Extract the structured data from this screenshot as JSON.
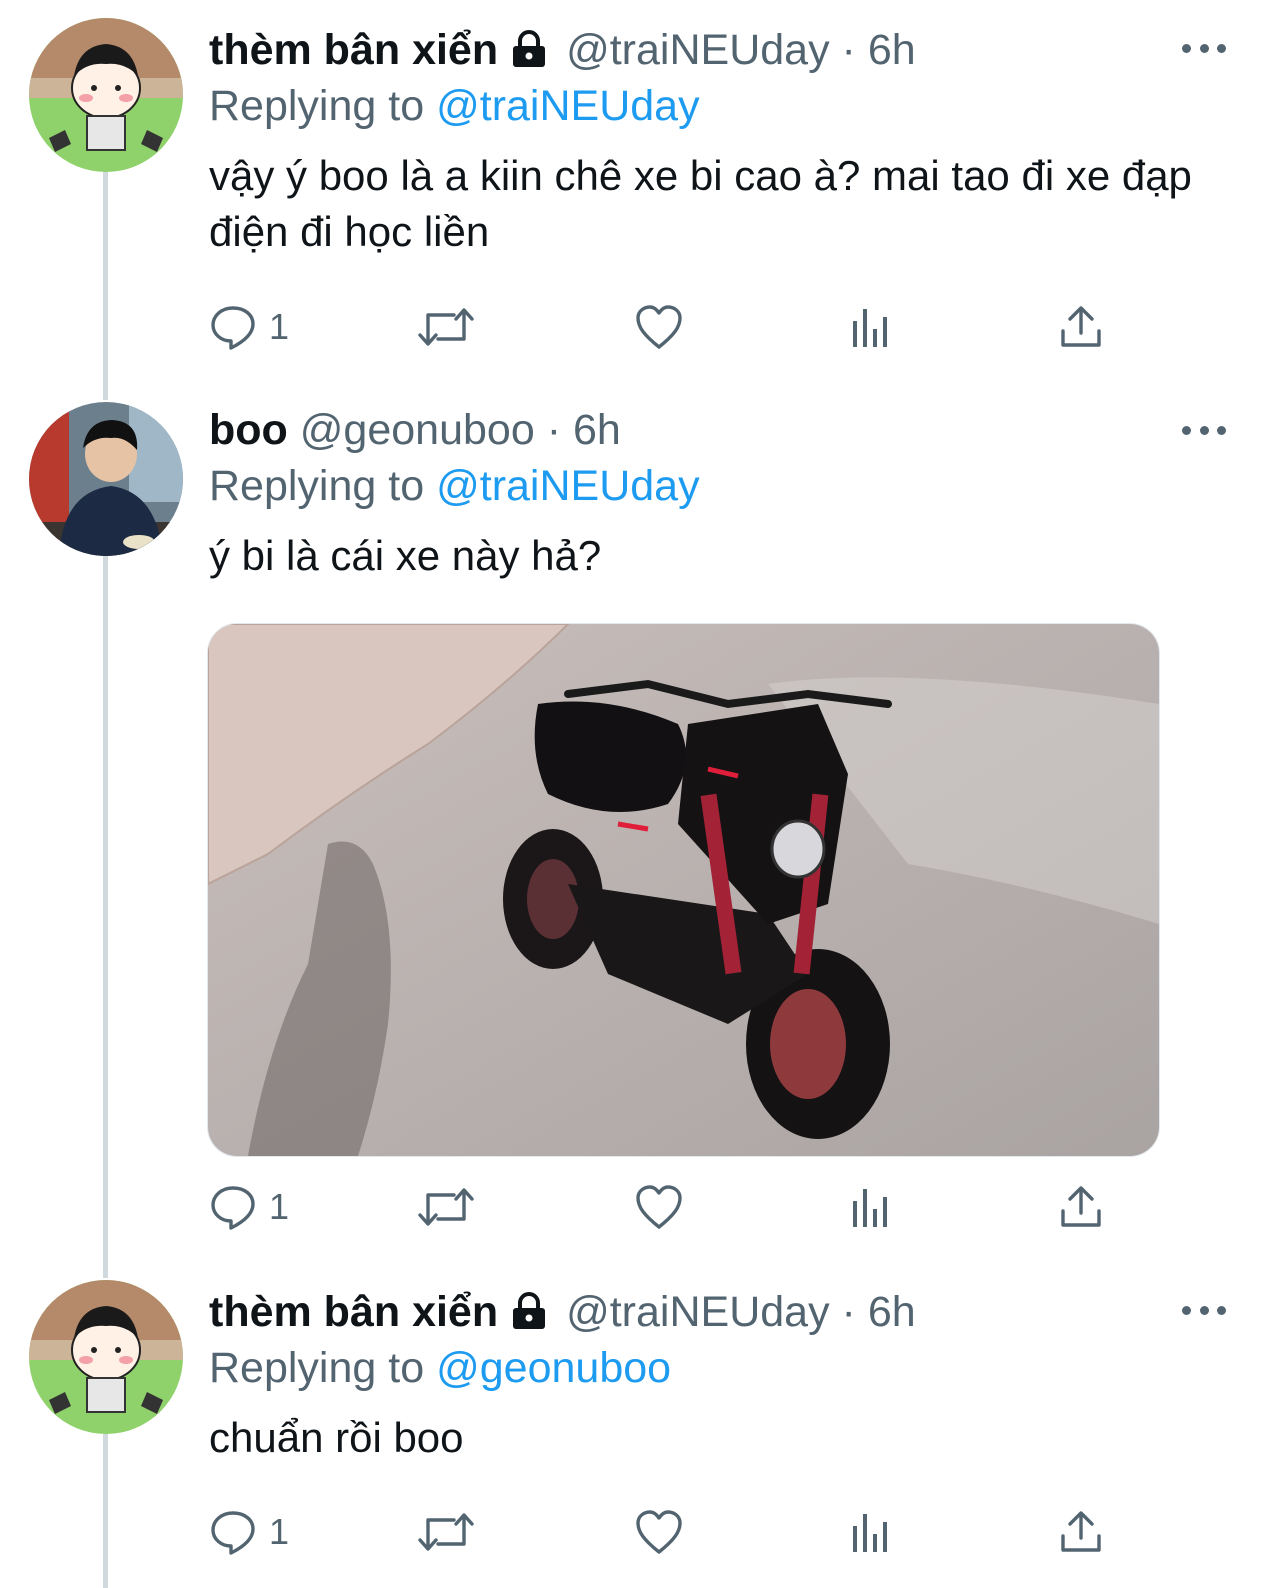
{
  "tweets": [
    {
      "name": "thèm bân xiển",
      "handle": "@traiNEUday",
      "dot": "·",
      "time": "6h",
      "replying_prefix": "Replying to",
      "replying_to": "@traiNEUday",
      "text": "vậy ý boo là a kiin chê xe bi cao à? mai tao đi xe đạp điện đi học liền",
      "reply_count": "1",
      "locked": true
    },
    {
      "name": "boo",
      "handle": "@geonuboo",
      "dot": "·",
      "time": "6h",
      "replying_prefix": "Replying to",
      "replying_to": "@traiNEUday",
      "text": "ý bi là cái xe này hả?",
      "reply_count": "1",
      "locked": false
    },
    {
      "name": "thèm bân xiển",
      "handle": "@traiNEUday",
      "dot": "·",
      "time": "6h",
      "replying_prefix": "Replying to",
      "replying_to": "@geonuboo",
      "text": "chuẩn rồi boo",
      "reply_count": "1",
      "locked": true
    }
  ],
  "icons": {
    "reply": "speech-bubble-icon",
    "retweet": "retweet-icon",
    "like": "heart-icon",
    "views": "bar-chart-icon",
    "share": "share-upload-icon",
    "more": "more-dots-icon",
    "lock": "lock-icon"
  },
  "colors": {
    "link": "#1d9bf0",
    "secondary_text": "#536471",
    "primary_text": "#0f1419",
    "thread_line": "#cfd9de"
  }
}
